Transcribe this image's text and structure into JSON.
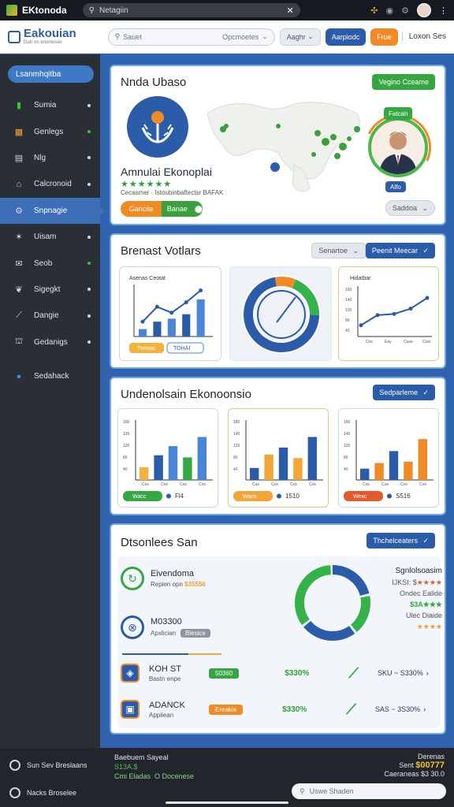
{
  "sysbar": {
    "brand": "EKtonoda",
    "url": "Netagiin"
  },
  "header": {
    "logo_title": "Eakouian",
    "logo_sub": "Dutr on enonessie",
    "search_placeholder": "Sauet",
    "search_option": "Opcmoetes",
    "btn_grey": "Aaghr",
    "btn_blue": "Aarpiodc",
    "btn_orange": "Frue",
    "profile_name": "Loxon Ses"
  },
  "sidebar": {
    "top_button": "Lsanmhqitba",
    "items": [
      {
        "label": "Sumia",
        "icon": "book-icon"
      },
      {
        "label": "Genlegs",
        "icon": "chart-icon"
      },
      {
        "label": "Nlg",
        "icon": "document-icon"
      },
      {
        "label": "Calcronoid",
        "icon": "tag-icon"
      },
      {
        "label": "Snpnagie",
        "icon": "gear-icon",
        "active": true
      },
      {
        "label": "Uisam",
        "icon": "star-icon"
      },
      {
        "label": "Seob",
        "icon": "mail-icon"
      },
      {
        "label": "Sigegkt",
        "icon": "bird-icon"
      },
      {
        "label": "Dangie",
        "icon": "pen-icon"
      },
      {
        "label": "Gedanigs",
        "icon": "cart-icon"
      }
    ],
    "extra_item": "Sedahack"
  },
  "card1": {
    "title": "Nnda Ubaso",
    "top_button": "Vegino Cceame",
    "name": "Amnulai Ekonoplai",
    "stars": "★★★★★★",
    "meta": "Cecasmer · Istoubinbaftectsr BAFAK",
    "action_left": "Gancila",
    "action_right": "Banae",
    "bottom_button": "Saddoa",
    "person_tag": "Alfo",
    "person_tag2": "Fatcah"
  },
  "card2": {
    "title": "Brenast Votlars",
    "btn_grey": "Senartoe",
    "btn_blue": "Peenit Meecar",
    "chart1": {
      "title": "Asenas Ceotat",
      "bar_values": [
        1,
        2,
        2.4,
        3,
        5
      ],
      "line_values": [
        2,
        4,
        3.2,
        4.6,
        6.2
      ],
      "ylim": [
        0,
        7
      ],
      "pill_yellow": "Ttemac",
      "pill_outline": "TOHAI"
    },
    "donut": {
      "segments": [
        0.09,
        0.19,
        0.72
      ],
      "colors": [
        "#f08a24",
        "#36b24a",
        "#2a5caa"
      ]
    },
    "chart3": {
      "title": "Hidatbar",
      "x_labels": [
        "Cos",
        "Eay",
        "Cuse",
        "Cosl"
      ],
      "y_labels": [
        "160",
        "140",
        "100",
        "80",
        "40"
      ],
      "line_values": [
        38,
        72,
        76,
        94,
        130
      ],
      "ylim": [
        0,
        170
      ]
    }
  },
  "card3": {
    "title": "Undenolsain Ekonoonsio",
    "btn_blue": "Sedparleme",
    "charts": [
      {
        "y_labels": [
          "160",
          "130",
          "120",
          "80",
          "40"
        ],
        "x_labels": [
          "Cos",
          "Coo",
          "Cos",
          "Cos"
        ],
        "values": [
          36,
          70,
          96,
          64,
          122
        ],
        "colors": [
          "#f4b23c",
          "#2a5caa",
          "#4a86d8",
          "#36a843",
          "#4a86d8"
        ],
        "ylim": [
          0,
          170
        ],
        "pill": "Wacc",
        "pill_color": "#36a843",
        "value_text": "Fl4"
      },
      {
        "y_labels": [
          "180",
          "140",
          "120",
          "80",
          "40"
        ],
        "x_labels": [
          "Cus",
          "Cos",
          "Cos",
          "Cos"
        ],
        "values": [
          34,
          72,
          92,
          62,
          122
        ],
        "colors": [
          "#2a5caa",
          "#f2a63a",
          "#2a5caa",
          "#f2a63a",
          "#2a5caa"
        ],
        "ylim": [
          0,
          170
        ],
        "pill": "Wace",
        "pill_color": "#f2a63a",
        "value_text": "1510"
      },
      {
        "y_labels": [
          "160",
          "140",
          "120",
          "80",
          "40"
        ],
        "x_labels": [
          "Cos",
          "Coo",
          "Cos",
          "Cos"
        ],
        "values": [
          32,
          48,
          82,
          52,
          116
        ],
        "colors": [
          "#2a5caa",
          "#f08a24",
          "#2a5caa",
          "#f08a24",
          "#f08a24"
        ],
        "ylim": [
          0,
          170
        ],
        "pill": "Wexc",
        "pill_color": "#e25a2c",
        "value_text": "S516"
      }
    ]
  },
  "card4": {
    "title": "Dtsonlees San",
    "btn_blue": "Thchelceaters",
    "rows": [
      {
        "title": "Eivendoma",
        "sub": "Repien opn",
        "value": "$35556"
      },
      {
        "title": "M03300",
        "sub": "Apxlician",
        "badge": "Blesice"
      },
      {
        "title": "KOH ST",
        "sub": "Bastn enpe",
        "badge": "50360",
        "mid": "$330%",
        "right": "SKU ~ S330%"
      },
      {
        "title": "ADANCK",
        "sub": "Appiiean",
        "badge": "Ereakie",
        "mid": "$330%",
        "right": "SAS ~ 3S30%"
      }
    ],
    "donut": {
      "segments": [
        0.22,
        0.18,
        0.25,
        0.35
      ],
      "colors": [
        "#2a5caa",
        "#36b24a",
        "#2a5caa",
        "#36b24a"
      ]
    },
    "legend_title": "Sgnlolsoasim",
    "legend": [
      {
        "label": "IJKSI: $",
        "stars": "★★★★"
      },
      {
        "label": "Ondec Ealide",
        "stars": "$3A★★★"
      },
      {
        "label": "Ulec Diaide",
        "stars": "★★★★"
      }
    ]
  },
  "bottombar": {
    "item1": "Sun Sev Breslaans",
    "item2": "Nacks Broselee",
    "mid_line1": "Baebuem Sayeal",
    "mid_line2": "S13A.$",
    "mid_line3": "Cmi Eladas",
    "mid_line4": "O Docenese",
    "right_line1": "Derenas",
    "right_line2": "Sent",
    "right_value": "$00777",
    "right_line3": "Caeraneas",
    "right_value2": "$3 30.0",
    "search": "Uswe Shaden"
  }
}
